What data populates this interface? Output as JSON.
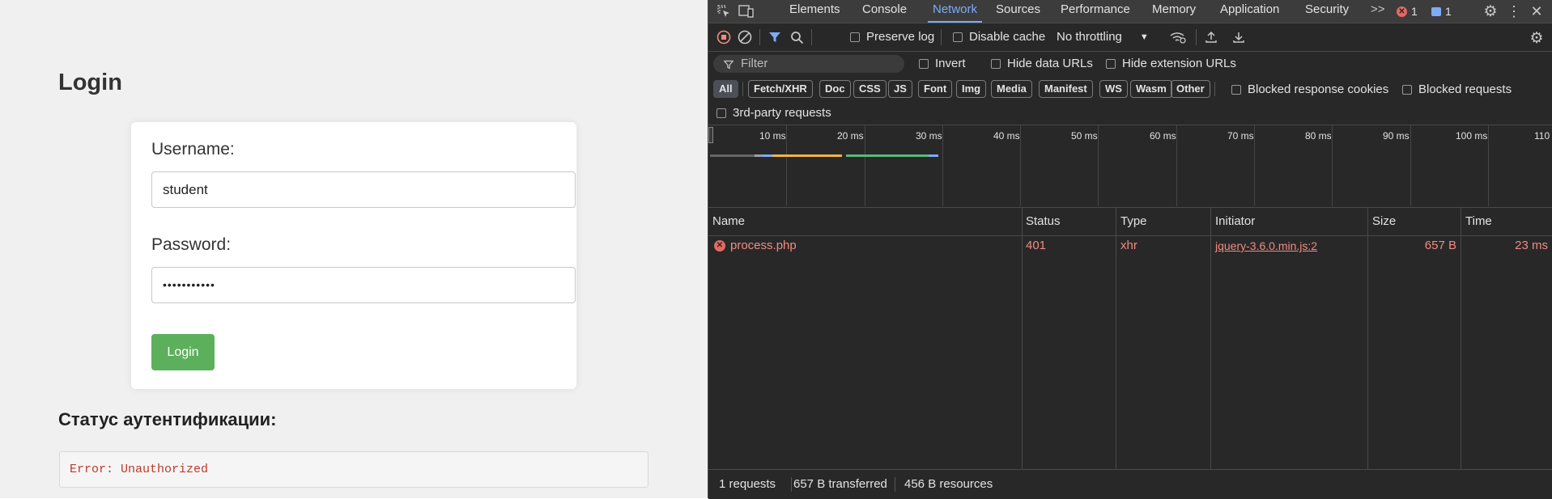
{
  "page": {
    "title": "Login",
    "username_label": "Username:",
    "username_value": "student",
    "password_label": "Password:",
    "password_value": "•••••••••••",
    "login_button": "Login",
    "status_heading": "Статус аутентификации:",
    "status_text": "Error: Unauthorized"
  },
  "devtools": {
    "tabs": [
      "Elements",
      "Console",
      "Network",
      "Sources",
      "Performance",
      "Memory",
      "Application",
      "Security"
    ],
    "active_tab": "Network",
    "more_tabs": ">>",
    "error_count": "1",
    "message_count": "1",
    "toolbar": {
      "preserve_log": "Preserve log",
      "disable_cache": "Disable cache",
      "throttling": "No throttling"
    },
    "filter": {
      "placeholder": "Filter",
      "invert": "Invert",
      "hide_data_urls": "Hide data URLs",
      "hide_extension_urls": "Hide extension URLs"
    },
    "type_chips": [
      "All",
      "Fetch/XHR",
      "Doc",
      "CSS",
      "JS",
      "Font",
      "Img",
      "Media",
      "Manifest",
      "WS",
      "Wasm",
      "Other"
    ],
    "blocked_response_cookies": "Blocked response cookies",
    "blocked_requests": "Blocked requests",
    "third_party": "3rd-party requests",
    "timeline_ticks": [
      "10 ms",
      "20 ms",
      "30 ms",
      "40 ms",
      "50 ms",
      "60 ms",
      "70 ms",
      "80 ms",
      "90 ms",
      "100 ms",
      "110"
    ],
    "columns": [
      "Name",
      "Status",
      "Type",
      "Initiator",
      "Size",
      "Time"
    ],
    "requests": [
      {
        "name": "process.php",
        "status": "401",
        "type": "xhr",
        "initiator": "jquery-3.6.0.min.js:2",
        "size": "657 B",
        "time": "23 ms"
      }
    ],
    "footer": {
      "requests": "1 requests",
      "transferred": "657 B transferred",
      "resources": "456 B resources"
    },
    "colors": {
      "accent": "#7cacf8",
      "error": "#f28b82",
      "record": "#f28b82"
    }
  }
}
